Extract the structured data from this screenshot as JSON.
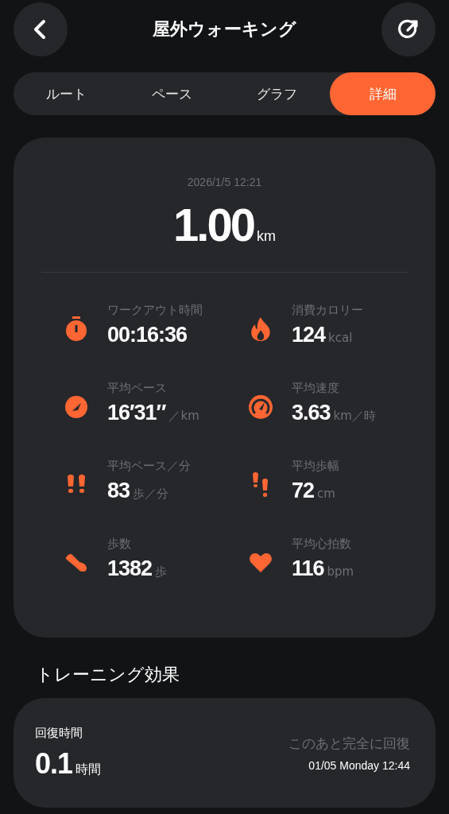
{
  "header": {
    "title": "屋外ウォーキング"
  },
  "tabs": [
    {
      "label": "ルート",
      "selected": false
    },
    {
      "label": "ペース",
      "selected": false
    },
    {
      "label": "グラフ",
      "selected": false
    },
    {
      "label": "詳細",
      "selected": true
    }
  ],
  "summary": {
    "datetime": "2026/1/5 12:21",
    "distance": "1.00",
    "distance_unit": "km"
  },
  "metrics": [
    {
      "kind": "stopwatch",
      "label": "ワークアウト時間",
      "value": "00:16:36"
    },
    {
      "kind": "flame",
      "label": "消費カロリー",
      "value": "124",
      "unit": "kcal"
    },
    {
      "kind": "pace",
      "label": "平均ペース",
      "value": "16′31″",
      "unit": "／km"
    },
    {
      "kind": "speed",
      "label": "平均速度",
      "value": "3.63",
      "unit": "km／時"
    },
    {
      "kind": "steps",
      "label": "平均ペース／分",
      "value": "83",
      "unit": "歩／分"
    },
    {
      "kind": "stride",
      "label": "平均歩幅",
      "value": "72",
      "unit": "cm"
    },
    {
      "kind": "shoe",
      "label": "歩数",
      "value": "1382",
      "unit": "歩"
    },
    {
      "kind": "heart",
      "label": "平均心拍数",
      "value": "116",
      "unit": "bpm"
    }
  ],
  "training_effect": {
    "title": "トレーニング効果",
    "recovery_label": "回復時間",
    "recovery_value": "0.1",
    "recovery_unit": "時間",
    "note": "このあと完全に回復",
    "recovery_time": "01/05 Monday 12:44"
  }
}
